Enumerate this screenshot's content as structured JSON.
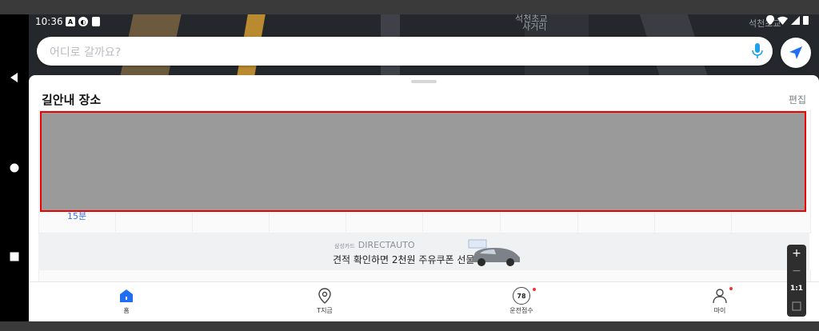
{
  "status_bar": {
    "time": "10:36"
  },
  "map": {
    "labels": [
      "석천초교",
      "사거리",
      "석천초교"
    ]
  },
  "search": {
    "placeholder": "어디로 갈까요?"
  },
  "sheet": {
    "title": "길안내 장소",
    "edit_label": "편집",
    "partial_text": "15분"
  },
  "ad": {
    "brand_small": "삼성카드",
    "brand": "DIRECTAUTO",
    "copy": "견적 확인하면 2천원 주유쿠폰 선물"
  },
  "tabs": [
    {
      "label": "홈",
      "badge": ""
    },
    {
      "label": "T지금",
      "badge": ""
    },
    {
      "label": "운전점수",
      "badge": "78"
    },
    {
      "label": "마이",
      "badge": ""
    }
  ],
  "zoom": {
    "plus": "+",
    "minus": "−",
    "ratio": "1:1"
  },
  "colors": {
    "accent": "#1f6ef5",
    "redaction_border": "#e00000",
    "notification_dot": "#e53935"
  }
}
